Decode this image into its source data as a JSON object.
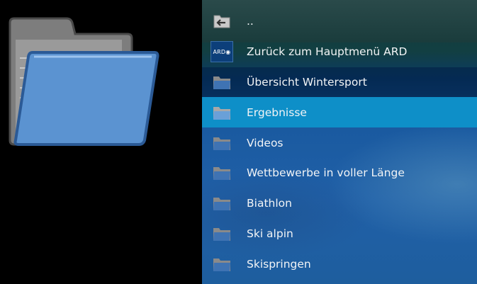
{
  "left_panel": {
    "icon": "large-folder-icon"
  },
  "list": {
    "items": [
      {
        "label": "..",
        "icon": "back-arrow-folder-icon",
        "state": "normal"
      },
      {
        "label": "Zurück zum Hauptmenü ARD",
        "icon": "ard-logo-icon",
        "logo_text": "ARD◉",
        "state": "normal"
      },
      {
        "label": "Übersicht Wintersport",
        "icon": "folder-icon",
        "state": "dark"
      },
      {
        "label": "Ergebnisse",
        "icon": "folder-icon",
        "state": "selected"
      },
      {
        "label": "Videos",
        "icon": "folder-icon",
        "state": "normal"
      },
      {
        "label": "Wettbewerbe in voller Länge",
        "icon": "folder-icon",
        "state": "normal"
      },
      {
        "label": "Biathlon",
        "icon": "folder-icon",
        "state": "normal"
      },
      {
        "label": "Ski alpin",
        "icon": "folder-icon",
        "state": "normal"
      },
      {
        "label": "Skispringen",
        "icon": "folder-icon",
        "state": "normal"
      }
    ]
  },
  "colors": {
    "selected_row": "#0e8fc8",
    "folder_blue": "#5b93d1",
    "folder_gray": "#8a8a8a"
  }
}
